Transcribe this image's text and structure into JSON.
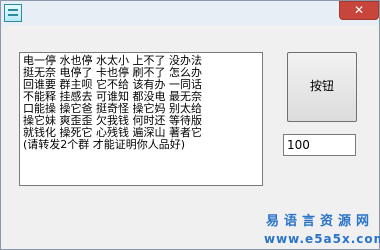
{
  "window": {
    "close_glyph": "✕"
  },
  "text_area": {
    "lines": [
      "电一停 水也停 水太小 上不了 没办法",
      "挺无奈 电停了 卡也停 刷不了 怎么办",
      "回谁要 群主呗 它不给 该有办 一同话",
      "不能释 挂感去 可谁知 都没电 最无奈",
      "口能操 操它爸 挺奇怪 操它妈 别太给",
      "操它妹 爽歪歪 欠我钱 何时还 等待版",
      "就钱化 操死它 心残钱 遍深山 著者它",
      "(请转发2个群 才能证明你人品好)"
    ]
  },
  "button": {
    "label": "按钮"
  },
  "input": {
    "value": "100"
  },
  "watermark": {
    "line1": "易语言资源网",
    "line2": "www.e5a5x.com"
  }
}
